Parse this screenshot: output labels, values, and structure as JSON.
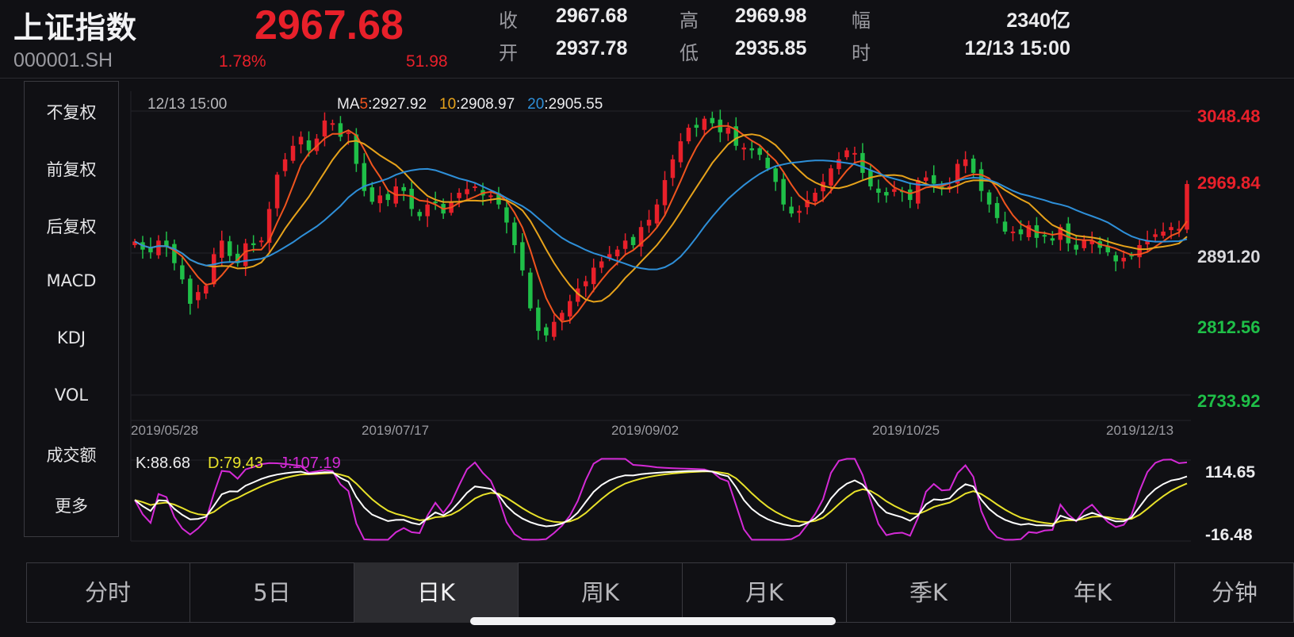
{
  "header": {
    "name": "上证指数",
    "code": "000001.SH",
    "price": "2967.68",
    "change_pct": "1.78%",
    "change_amt": "51.98",
    "quotes": [
      {
        "label": "收",
        "value": "2967.68"
      },
      {
        "label": "高",
        "value": "2969.98"
      },
      {
        "label": "幅",
        "value": "2340亿"
      },
      {
        "label": "开",
        "value": "2937.78"
      },
      {
        "label": "低",
        "value": "2935.85"
      },
      {
        "label": "时",
        "value": "12/13 15:00"
      }
    ]
  },
  "sidebar": {
    "items": [
      {
        "label": "不复权",
        "active": true
      },
      {
        "label": "前复权",
        "active": false
      },
      {
        "label": "后复权",
        "active": false
      },
      {
        "label": "MACD",
        "active": false
      },
      {
        "label": "KDJ",
        "active": true
      },
      {
        "label": "VOL",
        "active": false
      },
      {
        "label": "成交额",
        "active": false
      },
      {
        "label": "更多",
        "active": false
      }
    ]
  },
  "kline": {
    "cursor_time": "12/13 15:00",
    "ma_prefix": "MA",
    "ma5_label": "5",
    "ma5_value": ":2927.92",
    "ma10_label": "10",
    "ma10_value": ":2908.97",
    "ma20_label": "20",
    "ma20_value": ":2905.55",
    "price_axis": [
      "3048.48",
      "2969.84",
      "2891.20",
      "2812.56",
      "2733.92"
    ],
    "dates": [
      "2019/05/28",
      "2019/07/17",
      "2019/09/02",
      "2019/10/25",
      "2019/12/13"
    ]
  },
  "kdj": {
    "k_text": "K:88.68",
    "d_text": "D:79.43",
    "j_text": "J:107.19",
    "axis": [
      "114.65",
      "-16.48"
    ]
  },
  "tabs": [
    {
      "label": "分时",
      "active": false
    },
    {
      "label": "5日",
      "active": false
    },
    {
      "label": "日K",
      "active": true
    },
    {
      "label": "周K",
      "active": false
    },
    {
      "label": "月K",
      "active": false
    },
    {
      "label": "季K",
      "active": false
    },
    {
      "label": "年K",
      "active": false
    },
    {
      "label": "分钟",
      "active": false
    }
  ],
  "colors": {
    "up": "#e8202a",
    "down": "#1fbf48",
    "ma5": "#f0541e",
    "ma10": "#e6a21b",
    "ma20": "#2e8fd8",
    "kdj_k": "#ffffff",
    "kdj_d": "#e8e22a",
    "kdj_j": "#d42ad6",
    "accent": "#2f8fe8"
  },
  "chart_data": {
    "type": "candlestick",
    "price_range": [
      2733.92,
      3048.48
    ],
    "x_labels": [
      "2019/05/28",
      "2019/07/17",
      "2019/09/02",
      "2019/10/25",
      "2019/12/13"
    ],
    "closes": [
      2904,
      2895,
      2892,
      2905,
      2898,
      2880,
      2862,
      2835,
      2848,
      2855,
      2890,
      2905,
      2888,
      2880,
      2902,
      2900,
      2905,
      2940,
      2978,
      2995,
      3010,
      3020,
      3005,
      3018,
      3038,
      3035,
      3020,
      3025,
      2990,
      2960,
      2948,
      2955,
      2950,
      2965,
      2960,
      2940,
      2932,
      2945,
      2948,
      2935,
      2948,
      2958,
      2962,
      2965,
      2955,
      2955,
      2945,
      2925,
      2900,
      2872,
      2830,
      2805,
      2800,
      2815,
      2825,
      2838,
      2852,
      2860,
      2875,
      2882,
      2890,
      2895,
      2905,
      2900,
      2920,
      2928,
      2945,
      2972,
      2995,
      3015,
      3030,
      3030,
      3040,
      3035,
      3025,
      3030,
      3010,
      3008,
      3005,
      3000,
      2985,
      2970,
      2945,
      2935,
      2938,
      2950,
      2958,
      2970,
      2985,
      2995,
      3005,
      3002,
      2980,
      2965,
      2958,
      2955,
      2962,
      2960,
      2950,
      2972,
      2975,
      2968,
      2962,
      2965,
      2990,
      2995,
      2980,
      2960,
      2945,
      2930,
      2915,
      2915,
      2912,
      2922,
      2908,
      2910,
      2905,
      2920,
      2902,
      2895,
      2905,
      2905,
      2897,
      2892,
      2882,
      2886,
      2889,
      2900,
      2905,
      2912,
      2915,
      2920,
      2918,
      2967.68
    ],
    "ma5_last": 2927.92,
    "ma10_last": 2908.97,
    "ma20_last": 2905.55,
    "kdj_range": [
      -16.48,
      114.65
    ],
    "k_last": 88.68,
    "d_last": 79.43,
    "j_last": 107.19
  }
}
